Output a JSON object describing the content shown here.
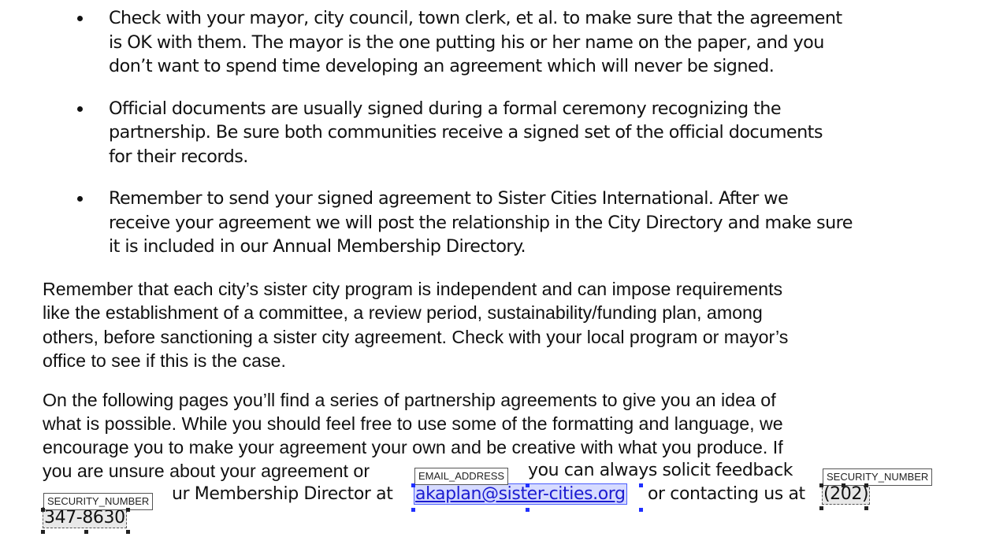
{
  "bullets": [
    {
      "text": "Check with your mayor, city council, town clerk, et al. to make sure that the agreement\nis OK with them. The mayor is the one putting his or her name on the paper, and you\ndon’t want to spend time developing an agreement which will never be signed."
    },
    {
      "text": "Official documents are usually signed during a formal ceremony recognizing the\npartnership.  Be sure both communities receive a signed set of the official documents\nfor their records."
    },
    {
      "text": "Remember to send your signed agreement to Sister Cities International. After we\nreceive your agreement we will post the relationship in the City Directory and make sure\nit is included in our Annual Membership Directory."
    }
  ],
  "paragraph1": "Remember that each city’s sister city program is independent and can impose requirements\nlike the establishment of a committee, a review period, sustainability/funding plan, among\nothers, before sanctioning a sister city agreement. Check with your local program or mayor’s\noffice to see if this is the case.",
  "paragraph2": {
    "line1": "On the following pages you’ll find a series of partnership agreements to give you an idea of",
    "line2": "what is possible. While you should feel free to use some of the formatting and language, we",
    "line3": "encourage you to make your agreement your own and be creative with what you produce. If",
    "line4a": "you are unsure about your agreement or",
    "line4b": "you can always solicit feedback",
    "line5a": "ur Membership Director at",
    "email": "akaplan@sister-cities.org",
    "line5b": "or contacting us at",
    "phone_part1": "(202)",
    "phone_part2": "347-8630"
  },
  "annotations": {
    "email_tag": "EMAIL_ADDRESS",
    "security_tag_right": "SECURITY_NUMBER",
    "security_tag_left": "SECURITY_NUMBER"
  },
  "colors": {
    "link": "#1b1bd0",
    "email_highlight": "#b4beff",
    "handle_blue": "#1f2fff"
  }
}
